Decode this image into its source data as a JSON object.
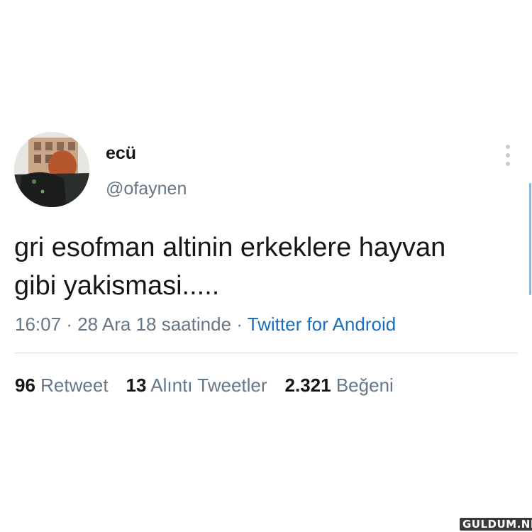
{
  "tweet": {
    "author": {
      "display_name": "ecü",
      "handle": "@ofaynen"
    },
    "text": "gri esofman altinin erkeklere hayvan\ngibi yakismasi.....",
    "meta": {
      "time": "16:07",
      "separator": " · ",
      "date": "28 Ara 18 saatinde",
      "source": "Twitter for Android"
    },
    "stats": {
      "retweets": {
        "count": "96",
        "label": "Retweet"
      },
      "quotes": {
        "count": "13",
        "label": "Alıntı Tweetler"
      },
      "likes": {
        "count": "2.321",
        "label": "Beğeni"
      }
    }
  },
  "icons": {
    "more": "more-vertical-icon"
  },
  "colors": {
    "text_primary": "#14171a",
    "text_secondary": "#657786",
    "link": "#1b6fbf",
    "divider": "#d9dfe4"
  },
  "watermark": {
    "text": "GULDUM.NET"
  }
}
